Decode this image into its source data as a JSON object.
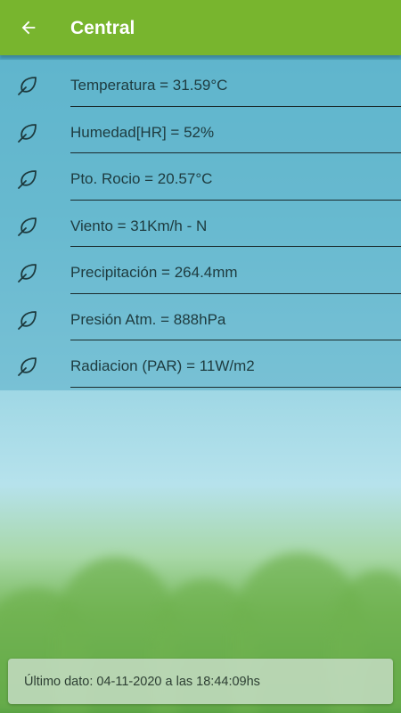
{
  "appbar": {
    "title": "Central",
    "color": "#78b52e"
  },
  "list": {
    "items": [
      {
        "label": "Temperatura = 31.59°C"
      },
      {
        "label": "Humedad[HR] = 52%"
      },
      {
        "label": "Pto. Rocio = 20.57°C"
      },
      {
        "label": "Viento = 31Km/h - N"
      },
      {
        "label": "Precipitación = 264.4mm"
      },
      {
        "label": "Presión Atm. = 888hPa"
      },
      {
        "label": "Radiacion (PAR) = 11W/m2"
      }
    ]
  },
  "footer": {
    "text": "Último dato: 04-11-2020 a las 18:44:09hs"
  }
}
